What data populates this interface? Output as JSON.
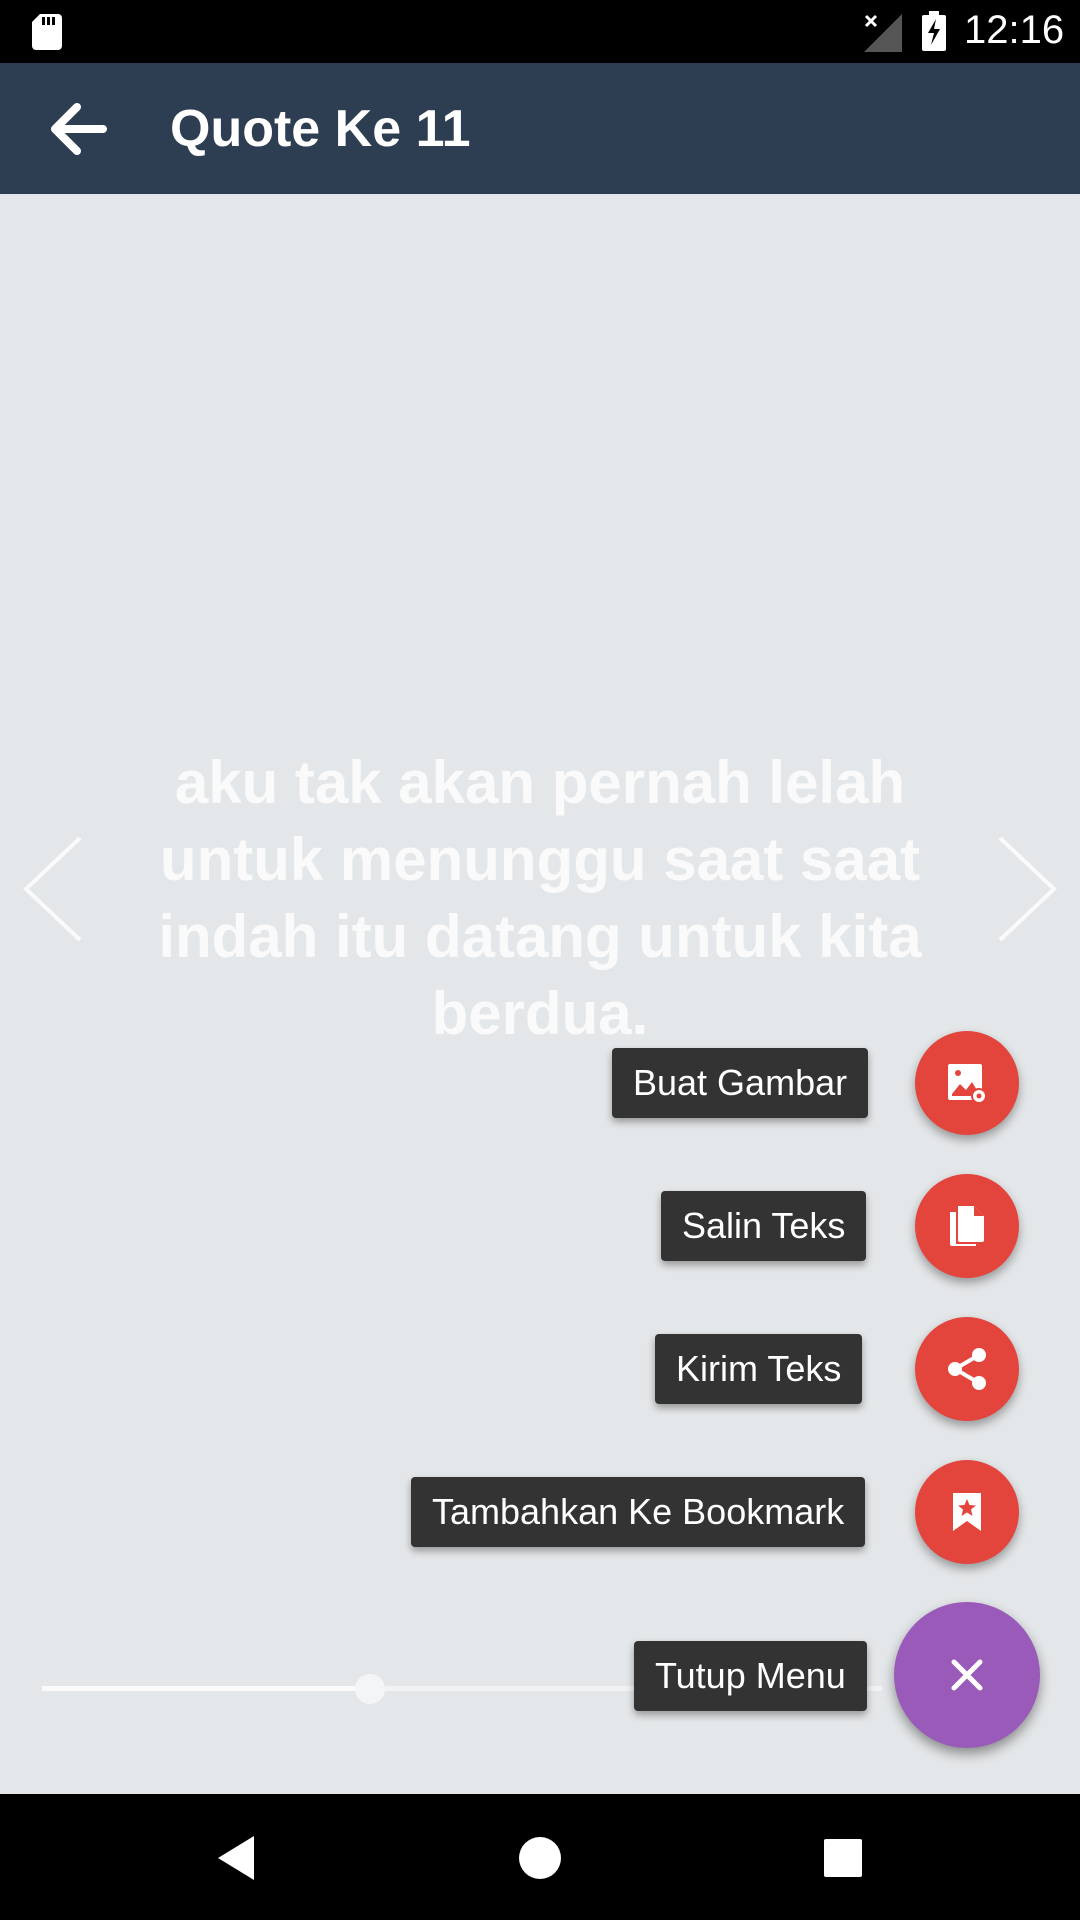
{
  "status_bar": {
    "time": "12:16",
    "icons": [
      "sd-card-icon",
      "no-signal-icon",
      "battery-charging-icon"
    ]
  },
  "app_bar": {
    "title": "Quote Ke 11",
    "back_icon": "arrow-back-icon"
  },
  "quote": {
    "text": "aku tak akan pernah lelah untuk menunggu saat saat indah itu datang untuk kita berdua."
  },
  "seekbar": {
    "progress_percent": 39
  },
  "fab_menu": {
    "items": [
      {
        "label": "Buat Gambar",
        "icon": "create-image-icon"
      },
      {
        "label": "Salin Teks",
        "icon": "copy-icon"
      },
      {
        "label": "Kirim Teks",
        "icon": "share-icon"
      },
      {
        "label": "Tambahkan Ke Bookmark",
        "icon": "bookmark-icon"
      }
    ],
    "close_label": "Tutup Menu",
    "close_icon": "close-icon"
  },
  "colors": {
    "app_bar": "#2e3e52",
    "background": "#e4e7e9",
    "fab_mini": "#e3443b",
    "fab_main": "#9a5ab9",
    "label_bg": "#333333"
  },
  "nav_bar": {
    "icons": [
      "back-triangle-icon",
      "home-circle-icon",
      "recents-square-icon"
    ]
  }
}
